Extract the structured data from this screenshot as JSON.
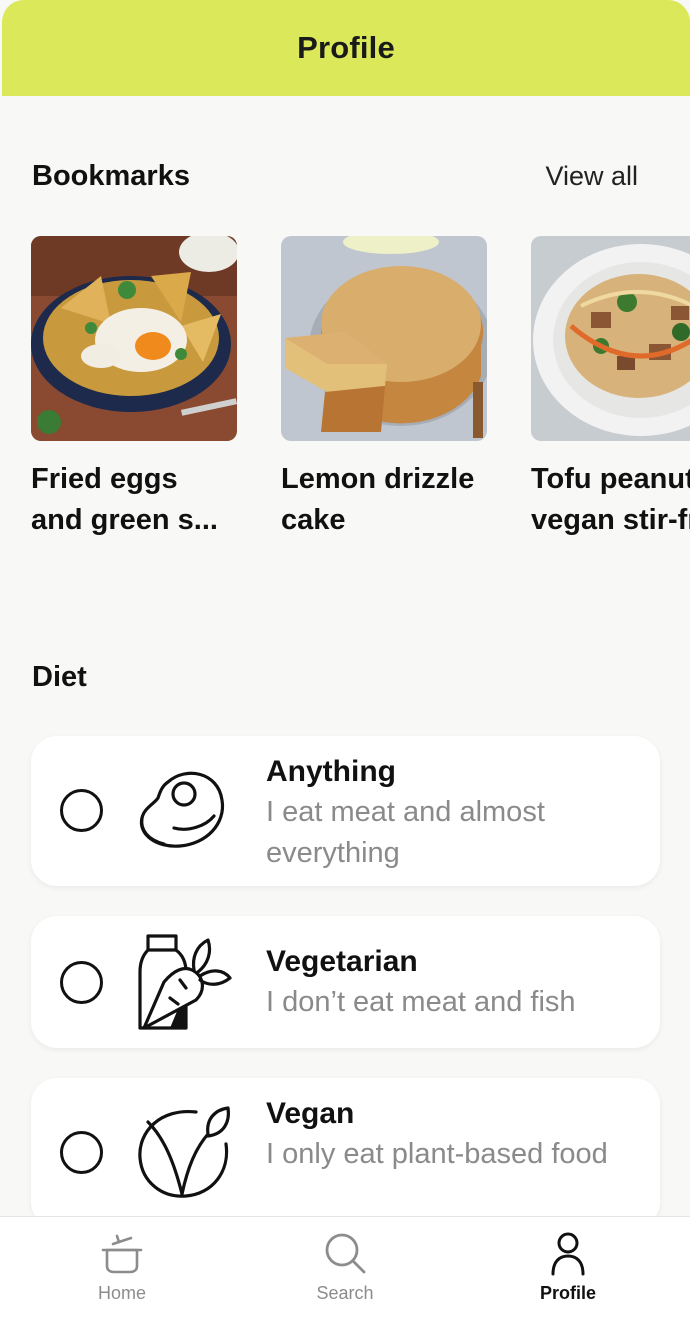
{
  "header": {
    "title": "Profile"
  },
  "bookmarks": {
    "heading": "Bookmarks",
    "view_all": "View all",
    "items": [
      {
        "title": "Fried eggs\nand green s..."
      },
      {
        "title": "Lemon drizzle\ncake"
      },
      {
        "title": "Tofu peanut\nvegan stir-fry"
      }
    ]
  },
  "diet": {
    "heading": "Diet",
    "options": [
      {
        "name": "Anything",
        "desc": "I eat meat and almost everything",
        "icon": "steak-icon",
        "selected": false
      },
      {
        "name": "Vegetarian",
        "desc": "I don’t eat meat and fish",
        "icon": "milk-carrot-icon",
        "selected": false
      },
      {
        "name": "Vegan",
        "desc": "I only eat plant-based food",
        "icon": "vegan-leaf-icon",
        "selected": false
      }
    ]
  },
  "tabbar": {
    "active": "Profile",
    "tabs": [
      {
        "label": "Home",
        "icon": "pot-icon"
      },
      {
        "label": "Search",
        "icon": "search-icon"
      },
      {
        "label": "Profile",
        "icon": "person-icon"
      }
    ]
  },
  "colors": {
    "header_bg": "#dbe85a",
    "page_bg": "#f8f8f6",
    "muted_text": "#8a8a8a"
  }
}
